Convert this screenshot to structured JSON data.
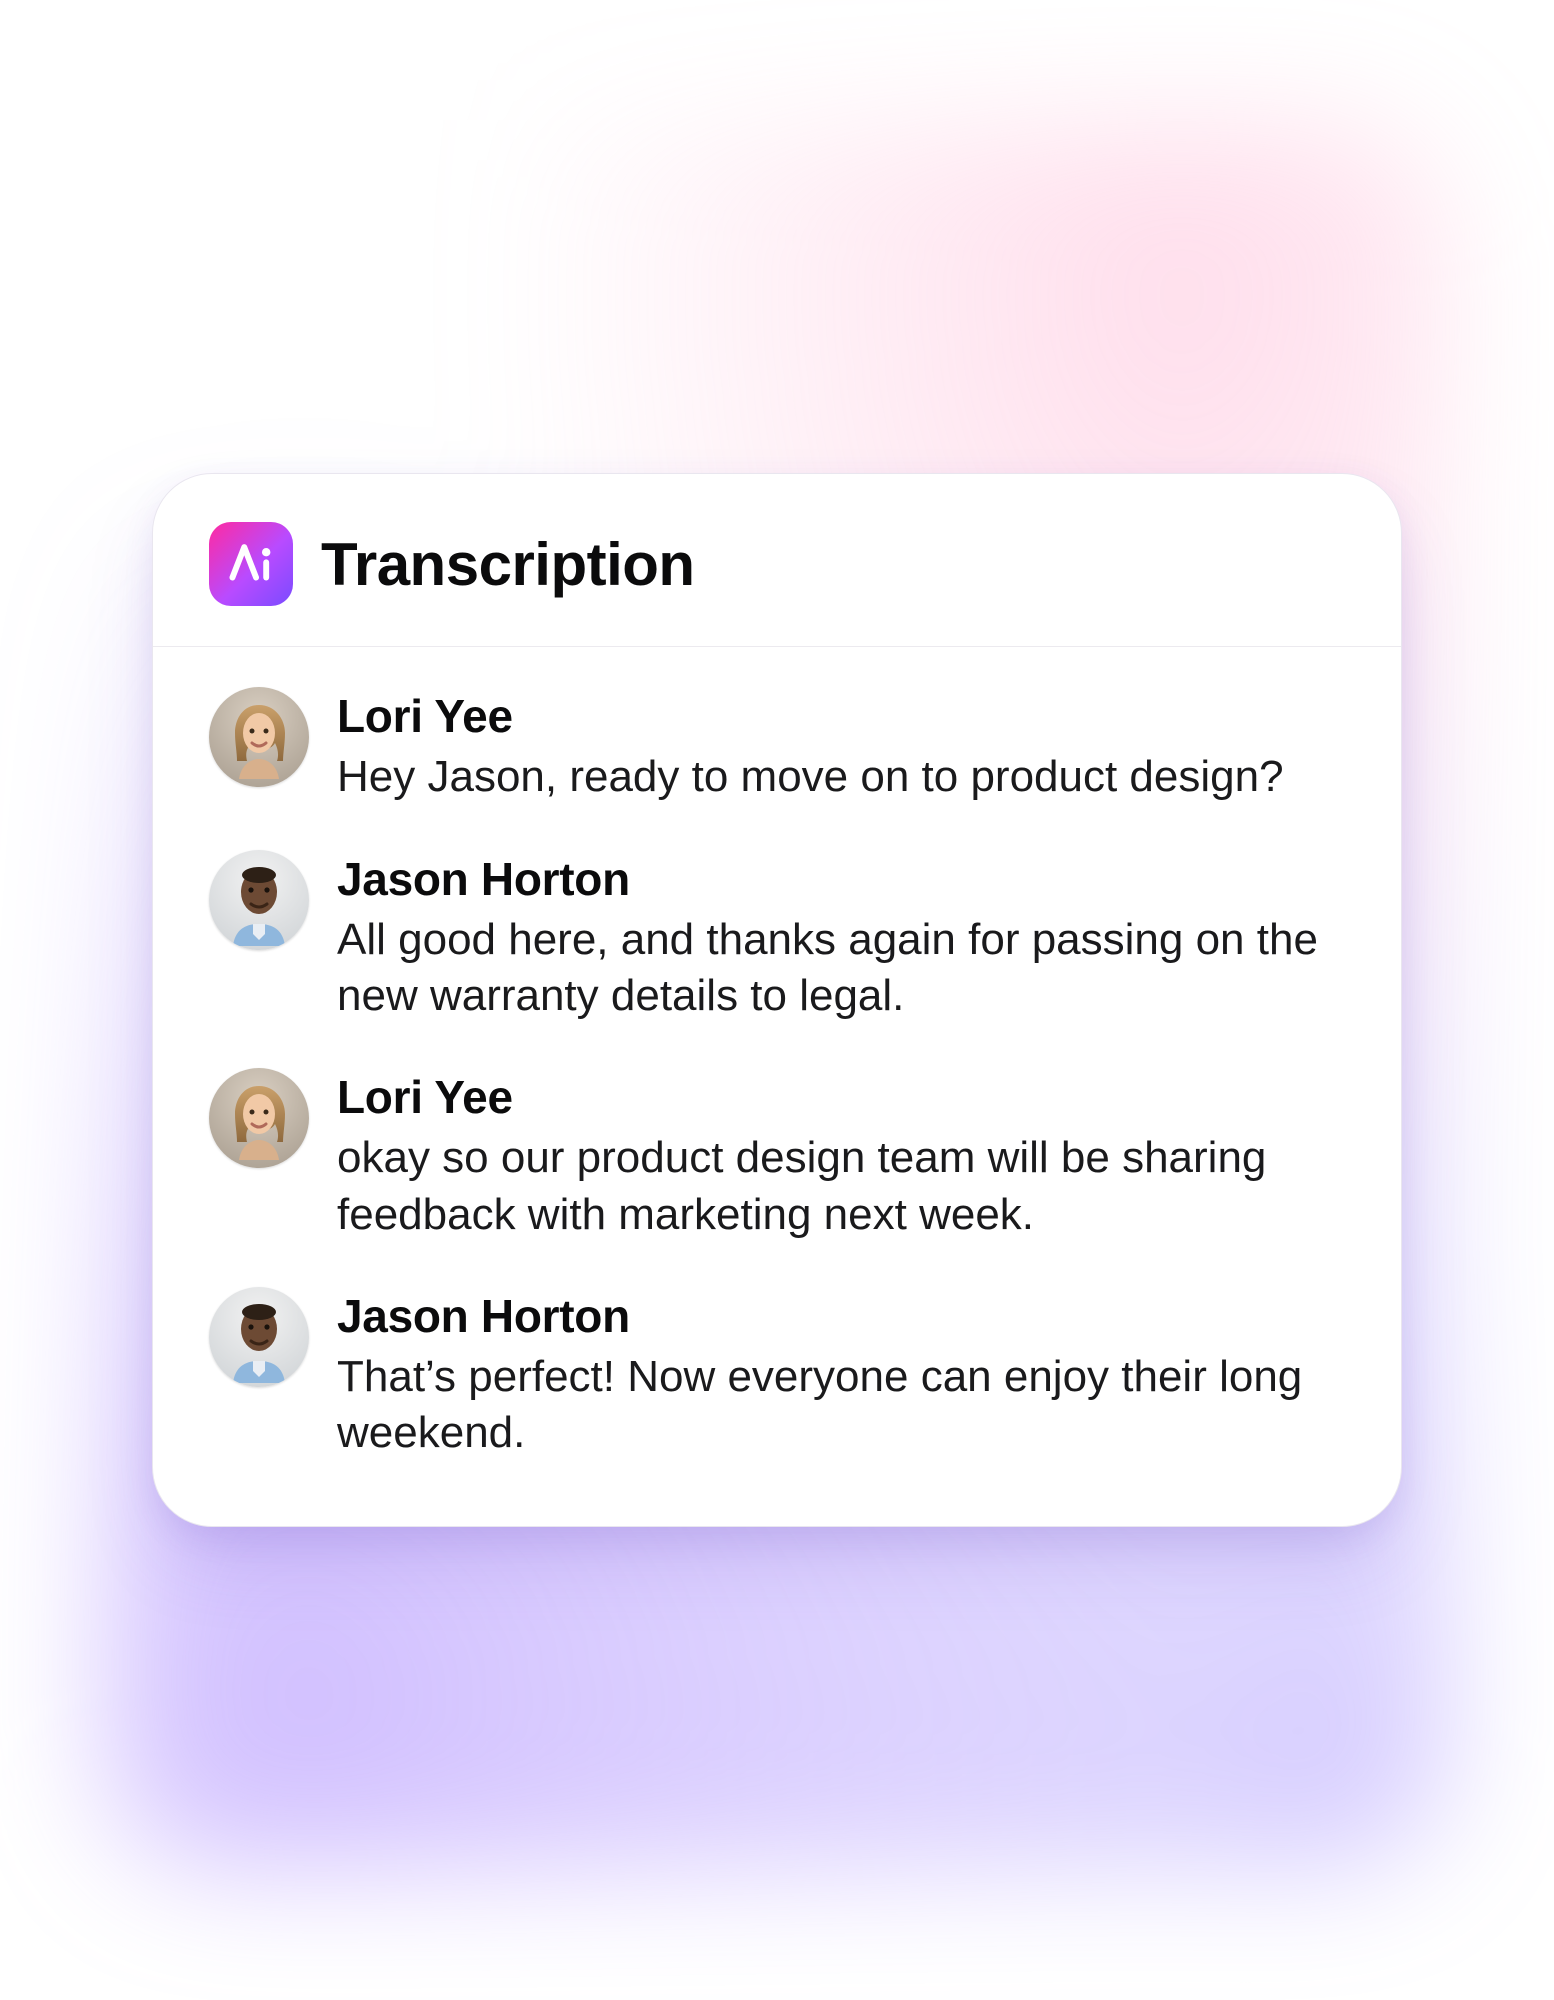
{
  "header": {
    "title": "Transcription",
    "app_icon": "ai-icon"
  },
  "colors": {
    "icon_gradient_start": "#ff2aa0",
    "icon_gradient_mid": "#b84bff",
    "icon_gradient_end": "#7a4bff"
  },
  "messages": [
    {
      "speaker": "Lori Yee",
      "avatar": "avatar-lori",
      "text": "Hey Jason, ready to move on to product design?"
    },
    {
      "speaker": "Jason Horton",
      "avatar": "avatar-jason",
      "text": "All good here, and thanks again for passing on the new warranty details to legal."
    },
    {
      "speaker": "Lori Yee",
      "avatar": "avatar-lori",
      "text": "okay so our product design team will be sharing feedback with marketing next week."
    },
    {
      "speaker": "Jason Horton",
      "avatar": "avatar-jason",
      "text": "That’s perfect! Now everyone can enjoy their long weekend."
    }
  ]
}
